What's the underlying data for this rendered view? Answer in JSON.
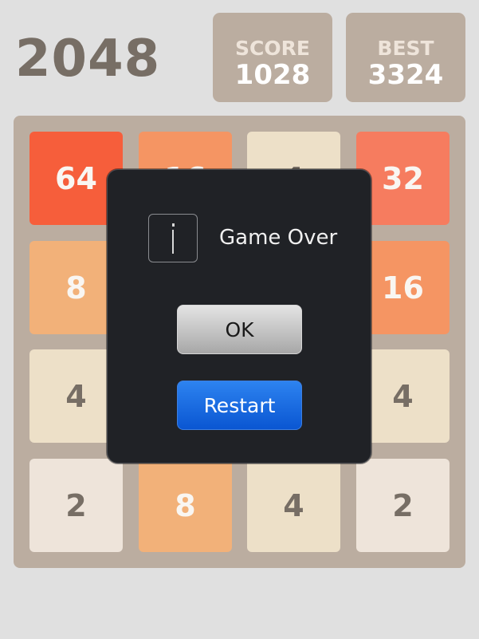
{
  "header": {
    "title": "2048",
    "score": {
      "label": "SCORE",
      "value": "1028"
    },
    "best": {
      "label": "BEST",
      "value": "3324"
    }
  },
  "board": {
    "rows": [
      [
        "64",
        "16",
        "4",
        "32"
      ],
      [
        "8",
        "",
        "",
        "16"
      ],
      [
        "4",
        "",
        "",
        "4"
      ],
      [
        "2",
        "8",
        "4",
        "2"
      ]
    ]
  },
  "dialog": {
    "icon": "info-icon",
    "message": "Game Over",
    "ok_label": "OK",
    "restart_label": "Restart"
  },
  "colors": {
    "tile_2": "#eee4da",
    "tile_4": "#ede0c8",
    "tile_8": "#f2b179",
    "tile_16": "#f59563",
    "tile_32": "#f67c5f",
    "tile_64": "#f65e3b",
    "board": "#bbada0",
    "restart_button": "#0a56d2"
  }
}
